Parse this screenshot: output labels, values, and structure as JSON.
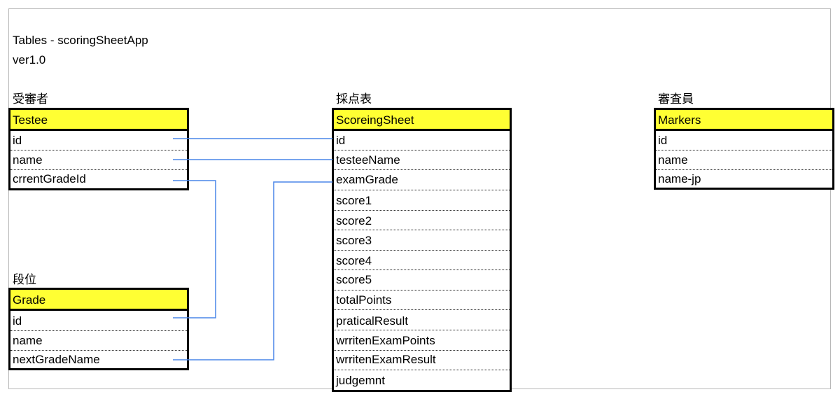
{
  "document": {
    "title": "Tables - scoringSheetApp",
    "version": "ver1.0"
  },
  "tables": {
    "testee": {
      "caption": "受審者",
      "name": "Testee",
      "fields": [
        "id",
        "name",
        "crrentGradeId"
      ]
    },
    "grade": {
      "caption": "段位",
      "name": "Grade",
      "fields": [
        "id",
        "name",
        "nextGradeName"
      ]
    },
    "scoring_sheet": {
      "caption": "採点表",
      "name": "ScoreingSheet",
      "fields": [
        "id",
        "testeeName",
        "examGrade",
        "score1",
        "score2",
        "score3",
        "score4",
        "score5",
        "totalPoints",
        "praticalResult",
        "wrritenExamPoints",
        "wrritenExamResult",
        "judgemnt"
      ]
    },
    "markers": {
      "caption": "審査員",
      "name": "Markers",
      "fields": [
        "id",
        "name",
        "name-jp"
      ]
    }
  },
  "colors": {
    "header_fill": "#ffff33",
    "connector": "#4a86e8",
    "frame": "#b7b7b7"
  }
}
